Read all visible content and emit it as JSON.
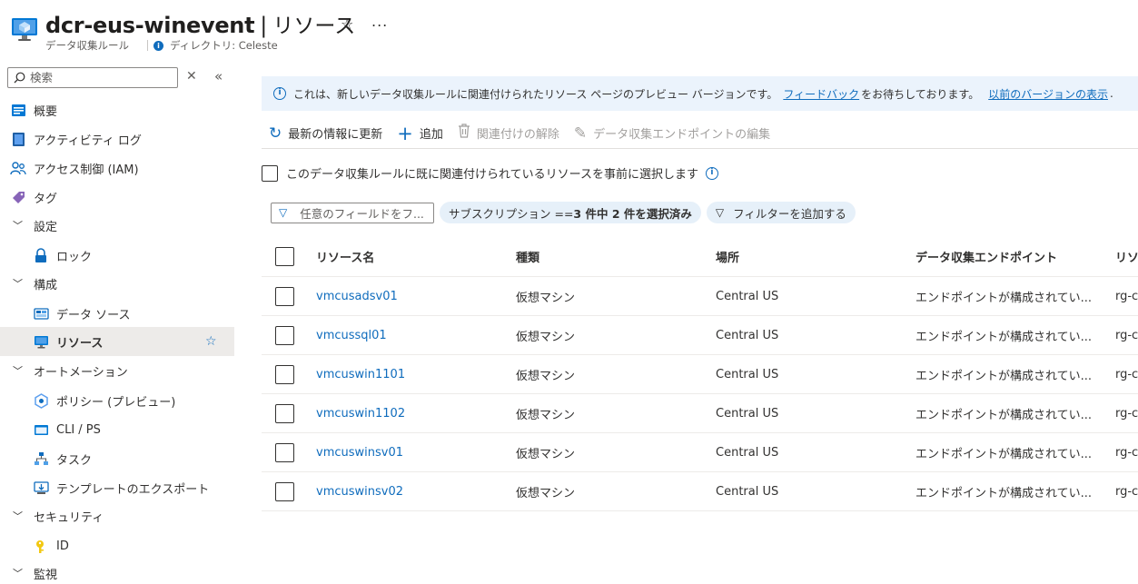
{
  "header": {
    "title": "dcr-eus-winevent",
    "separator": "|",
    "page": "リソース",
    "resource_type": "データ収集ルール",
    "directory": "ディレクトリ: Celeste",
    "more": "..."
  },
  "sidebar": {
    "search_placeholder": "検索",
    "items": [
      {
        "label": "概要",
        "icon": "overview-icon"
      },
      {
        "label": "アクティビティ ログ",
        "icon": "activity-log-icon"
      },
      {
        "label": "アクセス制御 (IAM)",
        "icon": "iam-icon"
      },
      {
        "label": "タグ",
        "icon": "tag-icon"
      },
      {
        "label": "設定",
        "group": true
      },
      {
        "label": "ロック",
        "icon": "lock-icon"
      },
      {
        "label": "構成",
        "group": true
      },
      {
        "label": "データ ソース",
        "icon": "data-source-icon"
      },
      {
        "label": "リソース",
        "icon": "resource-icon",
        "active": true
      },
      {
        "label": "オートメーション",
        "group": true
      },
      {
        "label": "ポリシー (プレビュー)",
        "icon": "policy-icon"
      },
      {
        "label": "CLI / PS",
        "icon": "cli-icon"
      },
      {
        "label": "タスク",
        "icon": "tasks-icon"
      },
      {
        "label": "テンプレートのエクスポート",
        "icon": "export-template-icon"
      },
      {
        "label": "セキュリティ",
        "group": true
      },
      {
        "label": "ID",
        "icon": "identity-icon"
      },
      {
        "label": "監視",
        "group": true
      }
    ]
  },
  "banner": {
    "text": "これは、新しいデータ収集ルールに関連付けられたリソース ページのプレビュー バージョンです。",
    "feedback_link": "フィードバック",
    "text2": "をお待ちしております。",
    "prev_link": "以前のバージョンの表示",
    "period": "."
  },
  "toolbar": {
    "refresh": "最新の情報に更新",
    "add": "追加",
    "disassociate": "関連付けの解除",
    "edit_endpoint": "データ収集エンドポイントの編集"
  },
  "preselect_label": "このデータ収集ルールに既に関連付けられているリソースを事前に選択します",
  "filters": {
    "placeholder": "任意のフィールドをフ...",
    "subscription_prefix": "サブスクリプション == ",
    "subscription_value": "3 件中 2 件を選択済み",
    "add_filter": "フィルターを追加する"
  },
  "table": {
    "columns": [
      "リソース名",
      "種類",
      "場所",
      "データ収集エンドポイント",
      "リソ"
    ],
    "rows": [
      [
        "vmcusadsv01",
        "仮想マシン",
        "Central US",
        "エンドポイントが構成されてい...",
        "rg-c"
      ],
      [
        "vmcussql01",
        "仮想マシン",
        "Central US",
        "エンドポイントが構成されてい...",
        "rg-c"
      ],
      [
        "vmcuswin1101",
        "仮想マシン",
        "Central US",
        "エンドポイントが構成されてい...",
        "rg-c"
      ],
      [
        "vmcuswin1102",
        "仮想マシン",
        "Central US",
        "エンドポイントが構成されてい...",
        "rg-c"
      ],
      [
        "vmcuswinsv01",
        "仮想マシン",
        "Central US",
        "エンドポイントが構成されてい...",
        "rg-c"
      ],
      [
        "vmcuswinsv02",
        "仮想マシン",
        "Central US",
        "エンドポイントが構成されてい...",
        "rg-c"
      ]
    ]
  },
  "colors": {
    "accent": "#0f6cbd",
    "banner_bg": "#ebf3fc",
    "active_bg": "#edebe9"
  }
}
